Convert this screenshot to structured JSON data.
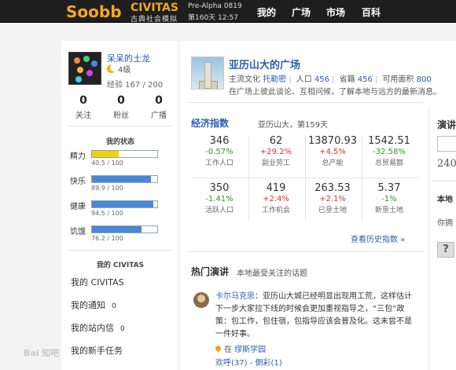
{
  "topbar": {
    "logo": "Soobb",
    "brand": "CIVITAS",
    "brand_sub": "古典社会模拟",
    "version": "Pre-Alpha 0819",
    "day_time": "第160天 12:57",
    "nav": [
      "我的",
      "广场",
      "市场",
      "百科"
    ]
  },
  "profile": {
    "name": "呆呆的土龙",
    "level": "4级",
    "exp": "经验 167 / 200",
    "stats": [
      {
        "value": "0",
        "label": "关注"
      },
      {
        "value": "0",
        "label": "粉丝"
      },
      {
        "value": "0",
        "label": "广播"
      }
    ]
  },
  "status": {
    "title": "我的状态",
    "bars": [
      {
        "label": "精力",
        "text": "40.5 / 100",
        "fraction": 0.405,
        "color": "#f2d20a"
      },
      {
        "label": "快乐",
        "text": "89.9 / 100",
        "fraction": 0.899,
        "color": "#4a86d8"
      },
      {
        "label": "健康",
        "text": "94.5 / 100",
        "fraction": 0.945,
        "color": "#4a86d8"
      },
      {
        "label": "饥饿",
        "text": "76.2 / 100",
        "fraction": 0.762,
        "color": "#4a86d8"
      }
    ]
  },
  "my_civitas": {
    "title": "我的 CIVITAS",
    "items": [
      {
        "label": "我的 CIVITAS",
        "count": ""
      },
      {
        "label": "我的通知",
        "count": "0"
      },
      {
        "label": "我的站内信",
        "count": "0"
      },
      {
        "label": "我的新手任务",
        "count": ""
      }
    ]
  },
  "plaza": {
    "title": "亚历山大的广场",
    "culture_label": "主流文化",
    "culture": "托勒密",
    "population_label": "人口",
    "population": "456",
    "province_label": "省籍",
    "province": "456",
    "area_label": "可用面积",
    "area": "800",
    "description": "在广场上彼此谈论、互相问候，了解本地与远方的最新消息。"
  },
  "economy": {
    "title": "经济指数",
    "subtitle": "亚历山大，第159天",
    "cells": [
      {
        "value": "346",
        "change": "-0.57%",
        "dir": "down",
        "label": "工作人口"
      },
      {
        "value": "62",
        "change": "+29.2%",
        "dir": "up",
        "label": "副业劳工"
      },
      {
        "value": "13870.93",
        "change": "+4.5%",
        "dir": "up",
        "label": "总产能"
      },
      {
        "value": "1542.51",
        "change": "-32.58%",
        "dir": "down",
        "label": "总贸易额"
      },
      {
        "value": "350",
        "change": "-1.41%",
        "dir": "down",
        "label": "活跃人口"
      },
      {
        "value": "419",
        "change": "+2.4%",
        "dir": "up",
        "label": "工作机会"
      },
      {
        "value": "263.53",
        "change": "+2.1%",
        "dir": "up",
        "label": "已垦土地"
      },
      {
        "value": "5.37",
        "change": "-1%",
        "dir": "down",
        "label": "新垦土地"
      }
    ],
    "history_link": "查看历史指数 »"
  },
  "hot": {
    "title": "热门演讲",
    "subtitle": "本地最受关注的话题",
    "speaker": "卡尔马克思",
    "speech": "：亚历山大城已经明显出现用工荒，这样估计下一步大家拉下线的时候会更加重视指导之，“三包”政策：包工作，包住宿，包指导应该会普及化。这未尝不是一件好事。",
    "location_prefix": "在",
    "location": "缪斯学园",
    "cheer": "欢呼(37)",
    "boo": "倒彩(1)"
  },
  "right": {
    "title": "演讲",
    "number": "240",
    "heading": "本地",
    "text": "你拥",
    "help": "?"
  },
  "watermark": "Bai 知吧"
}
